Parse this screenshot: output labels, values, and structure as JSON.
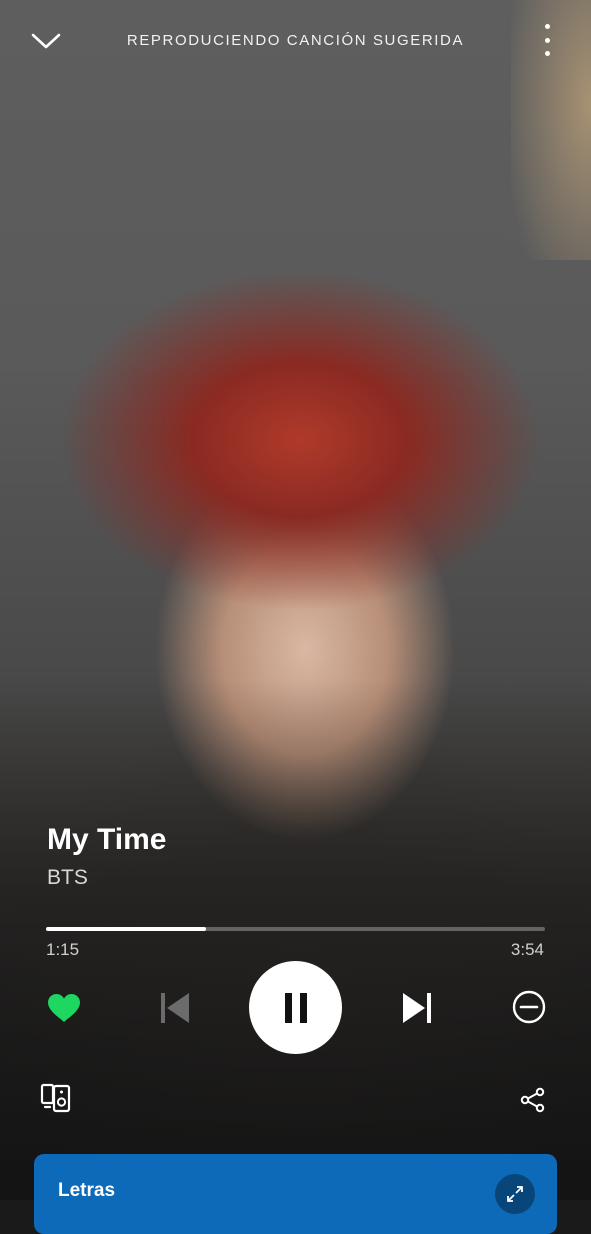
{
  "header": {
    "title": "REPRODUCIENDO CANCIÓN SUGERIDA",
    "collapse_icon": "chevron-down-icon",
    "menu_icon": "more-vertical-icon"
  },
  "track": {
    "title": "My Time",
    "artist": "BTS",
    "liked": true
  },
  "playback": {
    "elapsed": "1:15",
    "total": "3:54",
    "progress_fraction": 0.32,
    "state": "playing"
  },
  "colors": {
    "accent_green": "#1ed760",
    "lyrics_card": "#0d6ab8"
  },
  "lyrics": {
    "label": "Letras"
  }
}
